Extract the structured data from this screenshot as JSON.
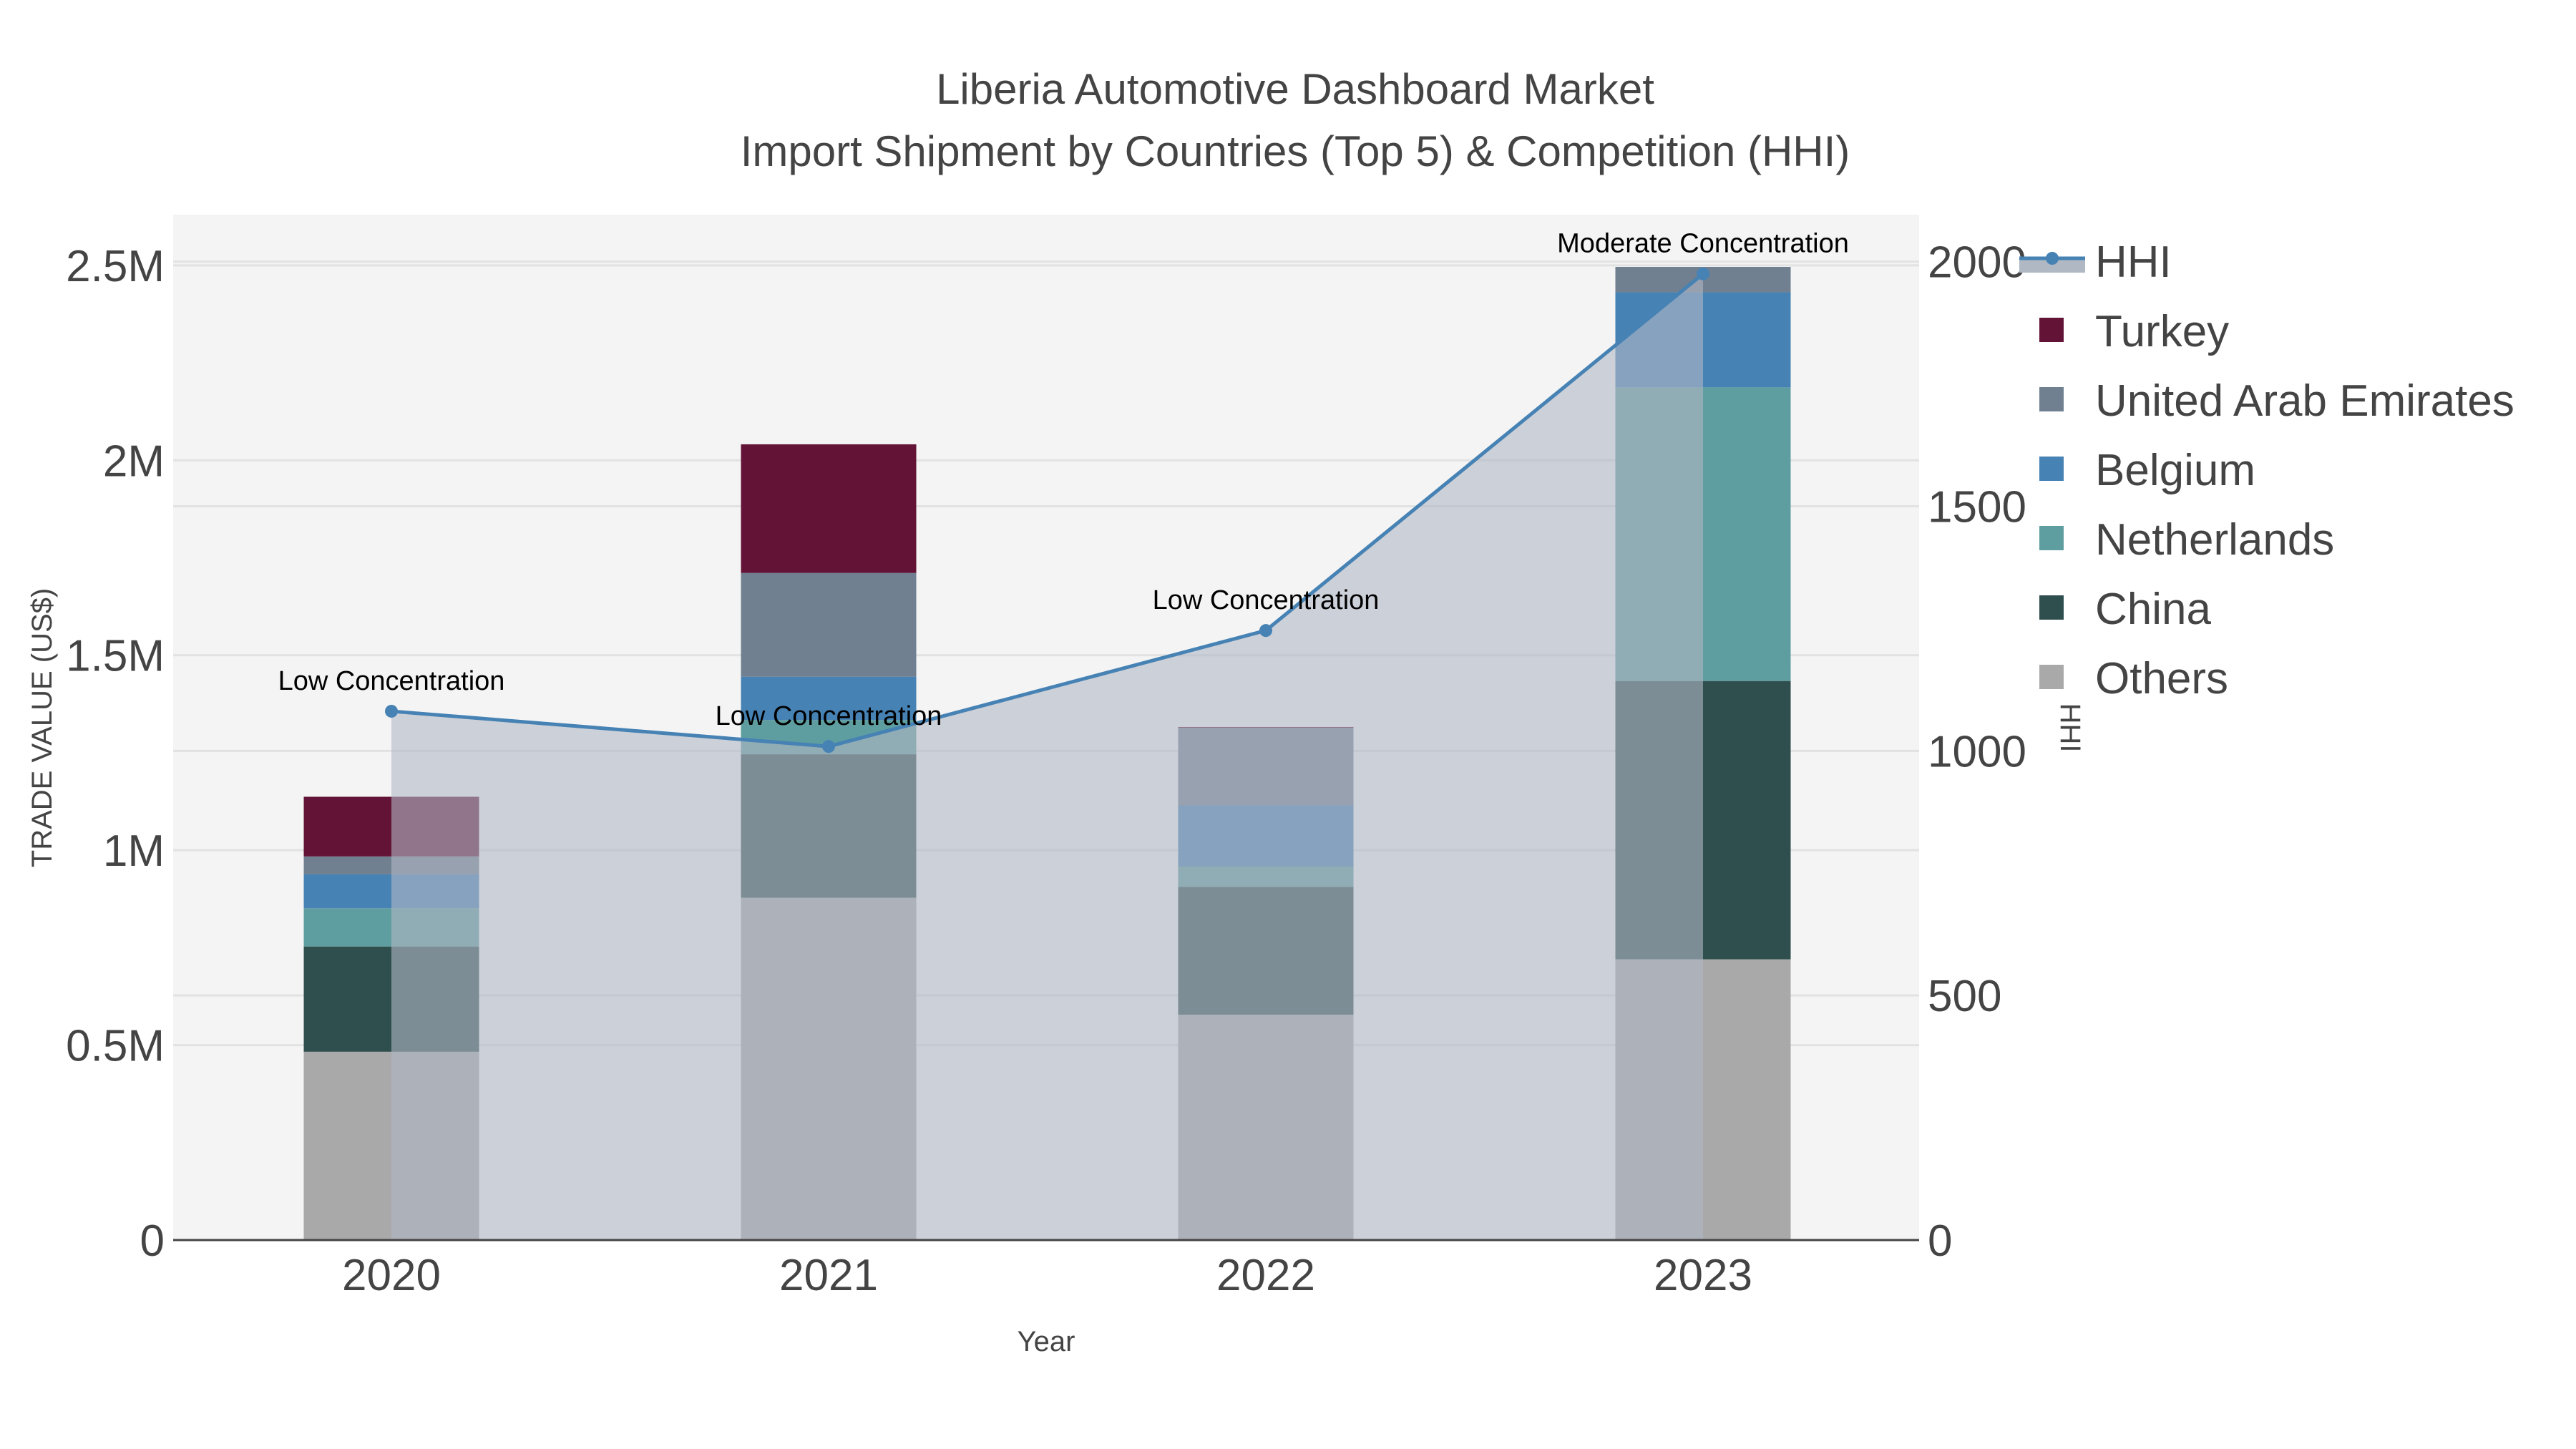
{
  "chart_data": {
    "type": "bar",
    "title": "Liberia Automotive Dashboard Market",
    "subtitle": "Import Shipment by Countries (Top 5) & Competition (HHI)",
    "xlabel": "Year",
    "ylabel": "TRADE VALUE (US$)",
    "y2label": "HHI",
    "categories": [
      "2020",
      "2021",
      "2022",
      "2023"
    ],
    "ylim": [
      0,
      2630000
    ],
    "y2lim": [
      0,
      2096
    ],
    "yticks": [
      0,
      500000,
      1000000,
      1500000,
      2000000,
      2500000
    ],
    "ytick_labels": [
      "0",
      "0.5M",
      "1M",
      "1.5M",
      "2M",
      "2.5M"
    ],
    "y2ticks": [
      0,
      500,
      1000,
      1500,
      2000
    ],
    "y2tick_labels": [
      "0",
      "500",
      "1000",
      "1500",
      "2000"
    ],
    "barmode": "stack",
    "series": [
      {
        "name": "Others",
        "color": "#a9a9a9",
        "values": [
          483000,
          878000,
          578000,
          720000
        ]
      },
      {
        "name": "China",
        "color": "#2f4f4f",
        "values": [
          270000,
          368000,
          328000,
          714000
        ]
      },
      {
        "name": "Netherlands",
        "color": "#5f9ea0",
        "values": [
          98000,
          88000,
          52000,
          753000
        ]
      },
      {
        "name": "Belgium",
        "color": "#4682b4",
        "values": [
          87000,
          111000,
          157000,
          244000
        ]
      },
      {
        "name": "United Arab Emirates",
        "color": "#708090",
        "values": [
          46000,
          266000,
          199000,
          65000
        ]
      },
      {
        "name": "Turkey",
        "color": "#631336",
        "values": [
          153000,
          330000,
          2000,
          0
        ]
      }
    ],
    "line": {
      "name": "HHI",
      "color": "#4682b4",
      "fill": "#b0b8c4",
      "values": [
        1081,
        1009,
        1246,
        1975
      ],
      "annotations": [
        "Low Concentration",
        "Low Concentration",
        "Low Concentration",
        "Moderate Concentration"
      ]
    },
    "legend_order": [
      "HHI",
      "Turkey",
      "United Arab Emirates",
      "Belgium",
      "Netherlands",
      "China",
      "Others"
    ],
    "legend_position": "right",
    "grid": true
  }
}
